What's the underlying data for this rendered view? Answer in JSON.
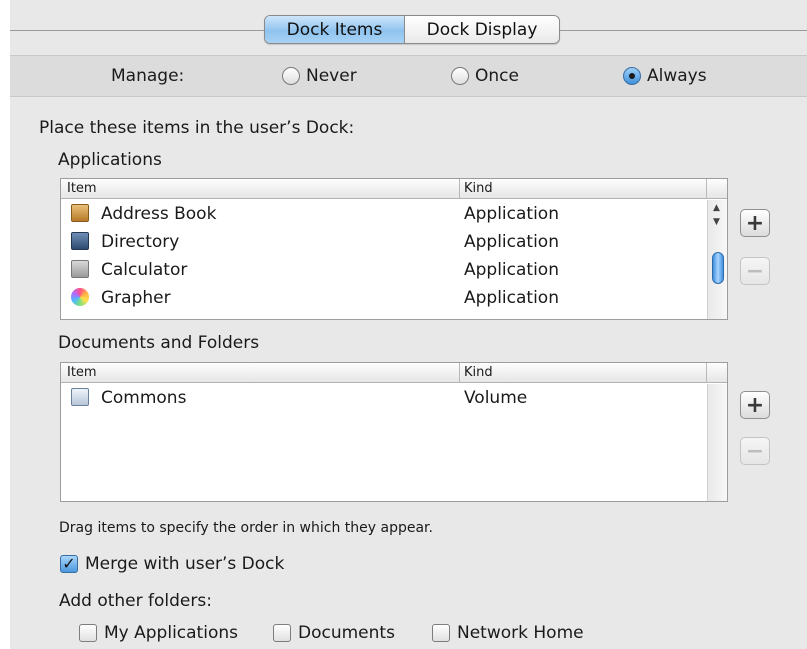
{
  "tabs": {
    "active": "Dock Items",
    "other": "Dock Display"
  },
  "manage": {
    "label": "Manage:",
    "options": [
      {
        "label": "Never",
        "selected": false
      },
      {
        "label": "Once",
        "selected": false
      },
      {
        "label": "Always",
        "selected": true
      }
    ]
  },
  "intro": "Place these items in the user’s Dock:",
  "applications": {
    "title": "Applications",
    "columns": [
      "Item",
      "Kind"
    ],
    "rows": [
      {
        "name": "Address Book",
        "kind": "Application",
        "icon": "address-book-icon"
      },
      {
        "name": "Directory",
        "kind": "Application",
        "icon": "directory-icon"
      },
      {
        "name": "Calculator",
        "kind": "Application",
        "icon": "calculator-icon"
      },
      {
        "name": "Grapher",
        "kind": "Application",
        "icon": "grapher-icon"
      }
    ]
  },
  "documents": {
    "title": "Documents and Folders",
    "columns": [
      "Item",
      "Kind"
    ],
    "rows": [
      {
        "name": "Commons",
        "kind": "Volume",
        "icon": "volume-icon"
      }
    ]
  },
  "buttons": {
    "add": "+",
    "remove": "−"
  },
  "drag_hint": "Drag items to specify the order in which they appear.",
  "merge": {
    "label": "Merge with user’s Dock",
    "checked": true
  },
  "add_other": {
    "title": "Add other folders:",
    "options": [
      {
        "label": "My Applications",
        "checked": false
      },
      {
        "label": "Documents",
        "checked": false
      },
      {
        "label": "Network Home",
        "checked": false
      }
    ]
  },
  "check_mark": "✓"
}
